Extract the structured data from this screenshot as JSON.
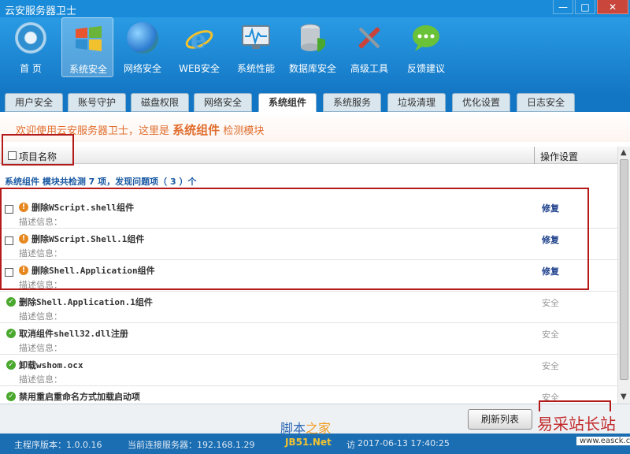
{
  "window": {
    "title": "云安服务器卫士",
    "min": "—",
    "max": "□",
    "close": "✕"
  },
  "toolbar": {
    "items": [
      {
        "label": "首 页",
        "icon": "home-dial-icon",
        "color": "#2f8fd0"
      },
      {
        "label": "系统安全",
        "icon": "windows-logo-icon",
        "color": "#e8542e"
      },
      {
        "label": "网络安全",
        "icon": "globe-icon",
        "color": "#3b8e3f"
      },
      {
        "label": "WEB安全",
        "icon": "ie-browser-icon",
        "color": "#2f7ad4"
      },
      {
        "label": "系统性能",
        "icon": "monitor-pulse-icon",
        "color": "#4aa3d8"
      },
      {
        "label": "数据库安全",
        "icon": "database-shield-icon",
        "color": "#9aa4ad"
      },
      {
        "label": "高级工具",
        "icon": "wrench-screwdriver-icon",
        "color": "#c8443b"
      },
      {
        "label": "反馈建议",
        "icon": "chat-bubble-icon",
        "color": "#6ac238"
      }
    ],
    "active_index": 1
  },
  "tabs": {
    "items": [
      "用户安全",
      "账号守护",
      "磁盘权限",
      "网络安全",
      "系统组件",
      "系统服务",
      "垃圾清理",
      "优化设置",
      "日志安全"
    ],
    "active_index": 4
  },
  "banner": {
    "prefix": "欢迎使用云安服务器卫士，这里是",
    "module": "系统组件",
    "suffix": "检测模块"
  },
  "table": {
    "col_name": "项目名称",
    "col_ops": "操作设置",
    "summary": "系统组件 模块共检测 7 项，发现问题项（ 3 ）个",
    "desc_label": "描述信息：",
    "items": [
      {
        "name": "删除WScript.shell组件",
        "action": "修复"
      },
      {
        "name": "删除WScript.Shell.1组件",
        "action": "修复"
      },
      {
        "name": "删除Shell.Application组件",
        "action": "修复"
      },
      {
        "name": "删除Shell.Application.1组件",
        "action": "安全"
      },
      {
        "name": "取消组件shell32.dll注册",
        "action": "安全"
      },
      {
        "name": "卸载wshom.ocx",
        "action": "安全"
      },
      {
        "name": "禁用重启重命名方式加载启动项",
        "action": "安全"
      }
    ]
  },
  "footer": {
    "refresh": "刷新列表"
  },
  "statusbar": {
    "version": "主程序版本：1.0.0.16",
    "server": "当前连接服务器：192.168.1.29",
    "time_prefix": "访",
    "time": "2017-06-13 17:40:25"
  },
  "watermarks": {
    "jb51_a": "脚本",
    "jb51_b": "之家",
    "jb51_url": "JB51.Net",
    "easck": "易采站长站",
    "easck_url": "www.easck.com"
  },
  "colors": {
    "accent": "#1a8bd8",
    "highlight": "#b51a1a",
    "warn": "#e6871f",
    "ok": "#4aa82e"
  }
}
